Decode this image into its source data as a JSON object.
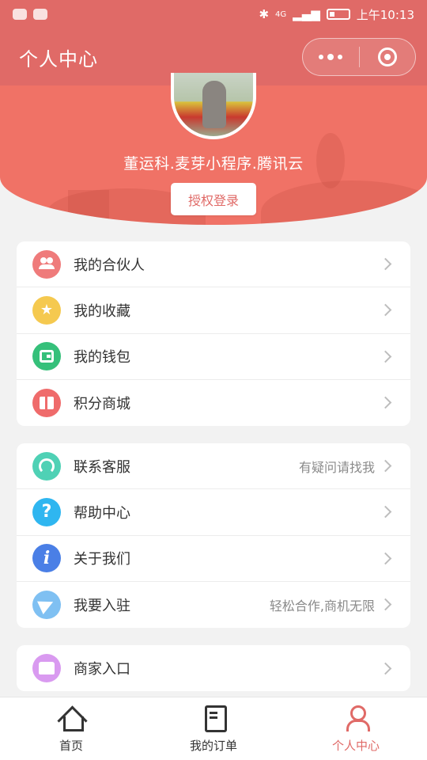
{
  "status_bar": {
    "time": "上午10:13",
    "network": "4G"
  },
  "nav": {
    "title": "个人中心"
  },
  "profile": {
    "name": "董运科.麦芽小程序.腾讯云",
    "auth_button": "授权登录"
  },
  "menu_group_1": [
    {
      "label": "我的合伙人",
      "hint": "",
      "icon": "people-icon",
      "color": "#ef7b7b"
    },
    {
      "label": "我的收藏",
      "hint": "",
      "icon": "star-icon",
      "color": "#f5c94f"
    },
    {
      "label": "我的钱包",
      "hint": "",
      "icon": "wallet-icon",
      "color": "#35c07a"
    },
    {
      "label": "积分商城",
      "hint": "",
      "icon": "gift-icon",
      "color": "#ef6b6b"
    }
  ],
  "menu_group_2": [
    {
      "label": "联系客服",
      "hint": "有疑问请找我",
      "icon": "headset-icon",
      "color": "#4fd1b5"
    },
    {
      "label": "帮助中心",
      "hint": "",
      "icon": "question-icon",
      "color": "#2fb6f0"
    },
    {
      "label": "关于我们",
      "hint": "",
      "icon": "info-icon",
      "color": "#4a7fe6"
    },
    {
      "label": "我要入驻",
      "hint": "轻松合作,商机无限",
      "icon": "paper-plane-icon",
      "color": "#7fc0f2"
    }
  ],
  "menu_group_3": [
    {
      "label": "商家入口",
      "hint": "",
      "icon": "store-icon",
      "color": "#d99af0"
    }
  ],
  "tabbar": [
    {
      "label": "首页",
      "icon": "home-icon"
    },
    {
      "label": "我的订单",
      "icon": "order-icon"
    },
    {
      "label": "个人中心",
      "icon": "user-icon"
    }
  ],
  "colors": {
    "header": "#e06a67",
    "banner": "#f07266",
    "page_bg": "#f2f2f2"
  }
}
